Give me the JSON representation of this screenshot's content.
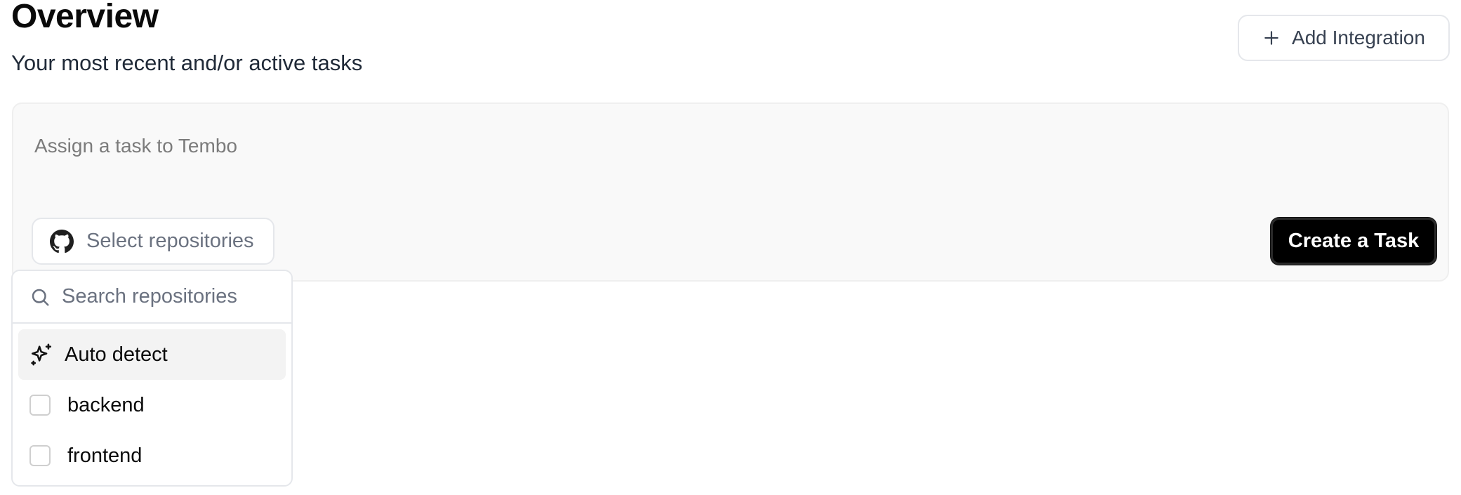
{
  "header": {
    "title": "Overview",
    "subtitle": "Your most recent and/or active tasks",
    "add_integration_label": "Add Integration",
    "add_integration_icon": "plus-icon"
  },
  "task_composer": {
    "placeholder": "Assign a task to Tembo",
    "select_repositories_label": "Select repositories",
    "select_repositories_icon": "github-icon",
    "create_task_label": "Create a Task"
  },
  "repo_dropdown": {
    "search_placeholder": "Search repositories",
    "search_icon": "search-icon",
    "auto_detect_label": "Auto detect",
    "auto_detect_icon": "sparkles-icon",
    "repositories": [
      {
        "label": "backend",
        "checked": false
      },
      {
        "label": "frontend",
        "checked": false
      }
    ]
  },
  "colors": {
    "primary_button": "#000000",
    "card_background": "#f9f9f9",
    "border": "#e5e7eb"
  }
}
